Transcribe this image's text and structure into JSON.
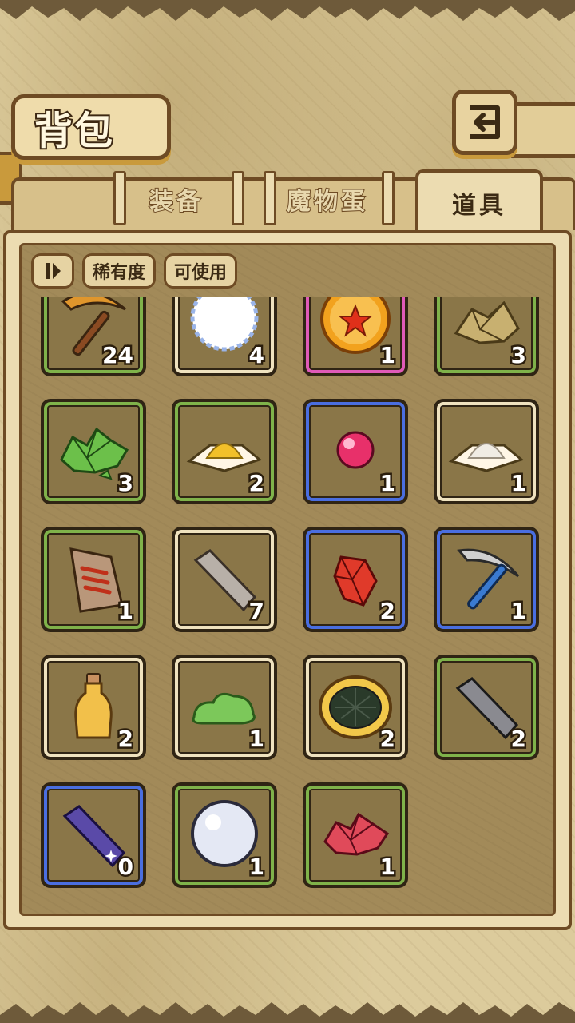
{
  "header": {
    "title": "背包"
  },
  "tabs": [
    {
      "label": "装备",
      "active": false
    },
    {
      "label": "魔物蛋",
      "active": false
    },
    {
      "label": "道具",
      "active": true
    }
  ],
  "filters": {
    "sort_icon": "sort-toggle-icon",
    "rarity_label": "稀有度",
    "usable_label": "可使用"
  },
  "items": [
    {
      "name": "pickaxe-wood-icon",
      "rarity": "green",
      "count": "24"
    },
    {
      "name": "snowball-icon",
      "rarity": "white",
      "count": "4"
    },
    {
      "name": "star-orb-icon",
      "rarity": "pink",
      "count": "1"
    },
    {
      "name": "ore-pile-icon",
      "rarity": "green",
      "count": "3"
    },
    {
      "name": "green-crystal-icon",
      "rarity": "green",
      "count": "3"
    },
    {
      "name": "gold-powder-icon",
      "rarity": "green",
      "count": "2"
    },
    {
      "name": "pink-pearl-icon",
      "rarity": "blue",
      "count": "1"
    },
    {
      "name": "white-powder-icon",
      "rarity": "white",
      "count": "1"
    },
    {
      "name": "fossil-tablet-icon",
      "rarity": "green",
      "count": "1"
    },
    {
      "name": "stone-ingot-icon",
      "rarity": "white",
      "count": "7"
    },
    {
      "name": "red-gem-icon",
      "rarity": "blue",
      "count": "2"
    },
    {
      "name": "pickaxe-steel-icon",
      "rarity": "blue",
      "count": "1"
    },
    {
      "name": "potion-bottle-icon",
      "rarity": "white",
      "count": "2"
    },
    {
      "name": "green-slime-icon",
      "rarity": "white",
      "count": "1"
    },
    {
      "name": "nest-icon",
      "rarity": "white",
      "count": "2"
    },
    {
      "name": "iron-ingot-icon",
      "rarity": "green",
      "count": "2"
    },
    {
      "name": "star-ingot-icon",
      "rarity": "blue",
      "count": "0"
    },
    {
      "name": "white-pearl-icon",
      "rarity": "green",
      "count": "1"
    },
    {
      "name": "red-crystal-icon",
      "rarity": "green",
      "count": "1"
    }
  ],
  "colors": {
    "rarity_white": "#efe2bf",
    "rarity_green": "#7fb24a",
    "rarity_blue": "#4a6ee0",
    "rarity_pink": "#e05ab8"
  }
}
